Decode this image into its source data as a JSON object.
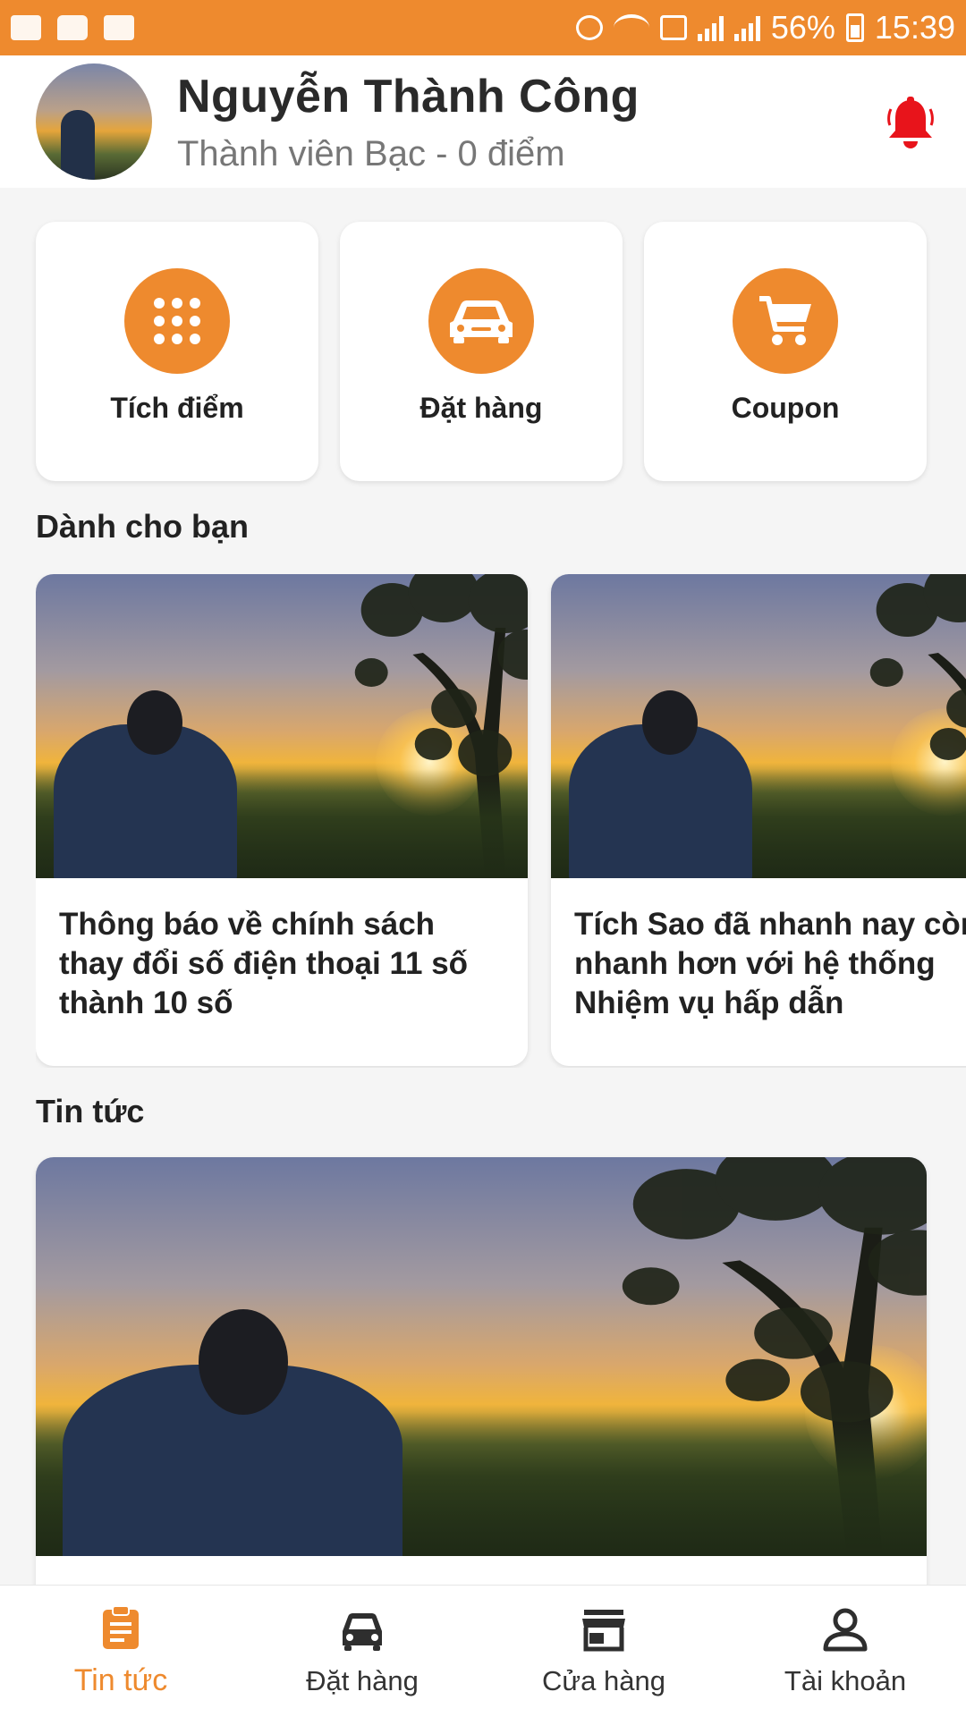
{
  "status_bar": {
    "battery": "56%",
    "time": "15:39"
  },
  "header": {
    "user_name": "Nguyễn Thành Công",
    "user_tier": "Thành viên Bạc  - 0 điểm"
  },
  "quick_actions": [
    {
      "label": "Tích điểm",
      "icon": "grid-dots-icon"
    },
    {
      "label": "Đặt hàng",
      "icon": "car-icon"
    },
    {
      "label": "Coupon",
      "icon": "cart-icon"
    }
  ],
  "for_you": {
    "title": "Dành cho bạn",
    "cards": [
      {
        "title": "Thông báo về chính sách thay đổi số điện thoại 11 số thành 10 số"
      },
      {
        "title": "Tích Sao đã nhanh nay còn nhanh hơn với hệ thống Nhiệm vụ hấp dẫn"
      }
    ]
  },
  "news": {
    "title": "Tin tức"
  },
  "bottom_nav": [
    {
      "label": "Tin tức",
      "active": true
    },
    {
      "label": "Đặt hàng",
      "active": false
    },
    {
      "label": "Cửa hàng",
      "active": false
    },
    {
      "label": "Tài khoản",
      "active": false
    }
  ],
  "colors": {
    "accent": "#ee8a2e",
    "bell": "#e8141b",
    "background": "#f5f5f5"
  }
}
